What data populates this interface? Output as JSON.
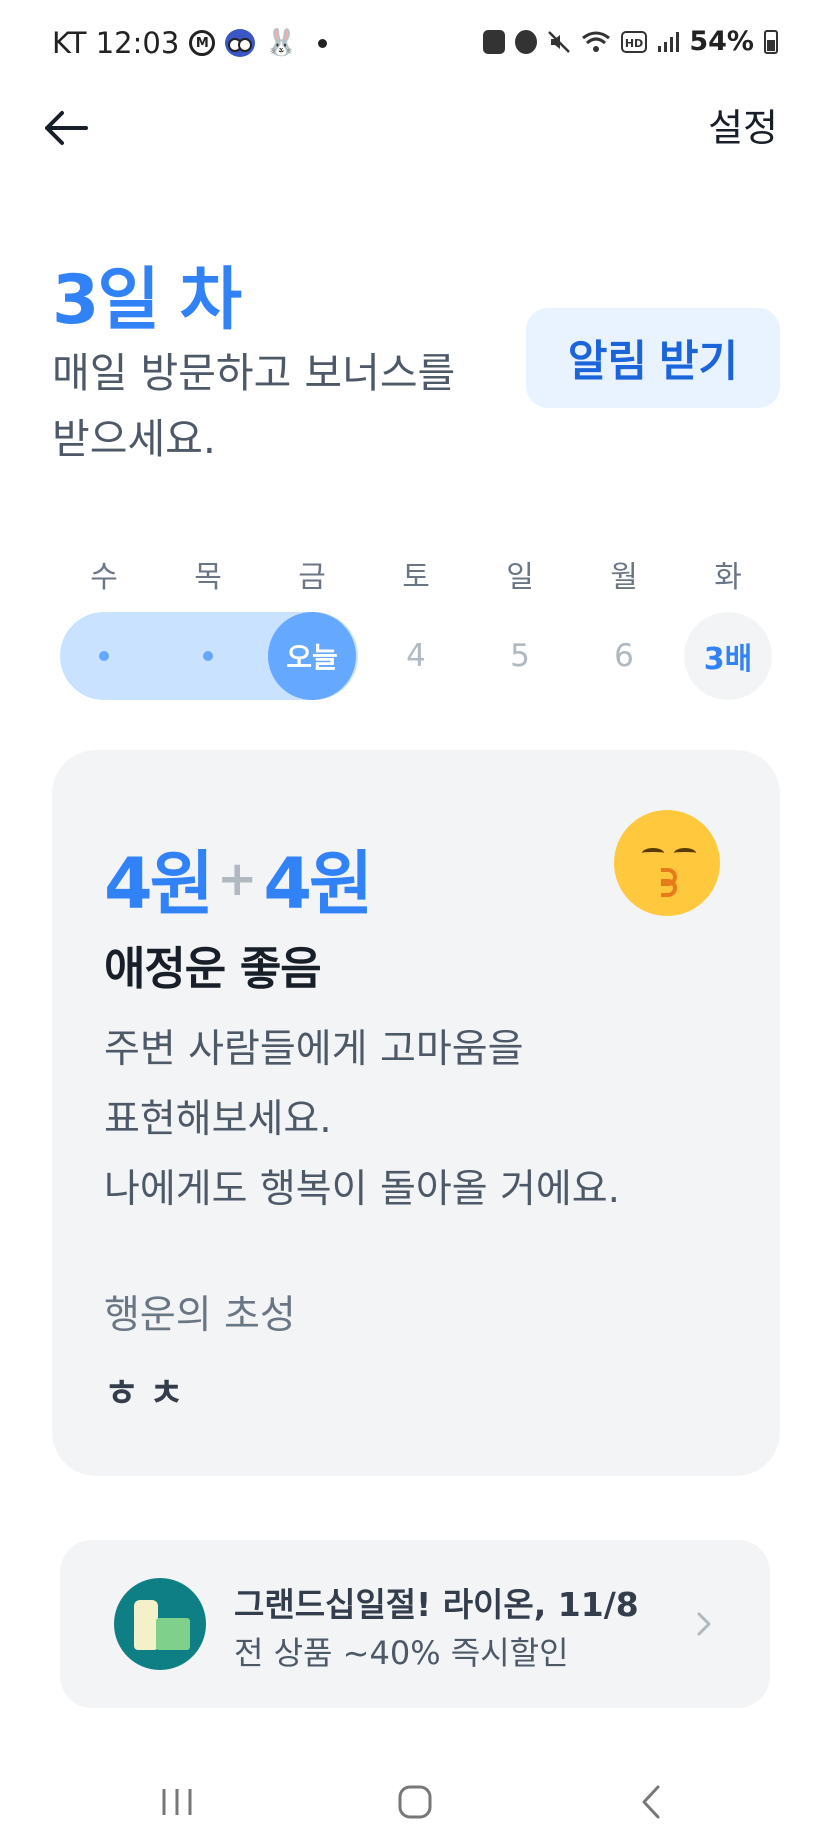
{
  "status_bar": {
    "carrier_time": "KT 12:03",
    "battery_percent": "54%",
    "left_icons": [
      "m-app-icon",
      "owl-icon",
      "rabbit-icon",
      "notification-dot"
    ],
    "right_icons": [
      "recycle-icon",
      "alarm-icon",
      "mute-icon",
      "wifi-icon",
      "hd-icon",
      "signal-icon",
      "battery-icon"
    ]
  },
  "header": {
    "back_icon": "back-arrow-icon",
    "settings_label": "설정"
  },
  "attendance": {
    "day_title": "3일 차",
    "subtitle": "매일 방문하고 보너스를 받으세요.",
    "notify_button_label": "알림 받기"
  },
  "week": {
    "weekdays": [
      "수",
      "목",
      "금",
      "토",
      "일",
      "월",
      "화"
    ],
    "today_label": "오늘",
    "upcoming_days": [
      "4",
      "5",
      "6"
    ],
    "bonus_label": "3배"
  },
  "fortune": {
    "reward_base": "4원",
    "reward_plus": "+",
    "reward_bonus": "4원",
    "emoji": "kissing-face-icon",
    "title": "애정운 좋음",
    "message_lines": [
      "주변 사람들에게 고마움을",
      "표현해보세요.",
      "나에게도 행복이 돌아올 거에요."
    ],
    "initials_label": "행운의 초성",
    "initials_value": "ㅎㅊ"
  },
  "ad": {
    "title": "그랜드십일절! 라이온, 11/8",
    "subtitle": "전 상품 ~40% 즉시할인"
  },
  "nav": {
    "buttons": [
      "recent-apps-icon",
      "home-icon",
      "back-icon"
    ]
  },
  "colors": {
    "accent": "#3182f6",
    "accent_light": "#c9e2ff",
    "today_fill": "#64a8ff",
    "card_bg": "#f2f4f6",
    "notify_bg": "#e8f3ff"
  }
}
